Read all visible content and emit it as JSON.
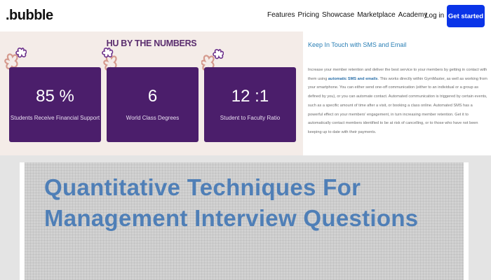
{
  "nav": {
    "logo": ".bubble",
    "links": [
      "Features",
      "Pricing",
      "Showcase",
      "Marketplace",
      "Academy"
    ],
    "login": "Log in",
    "cta": "Get started"
  },
  "stats": {
    "title": "HU BY THE NUMBERS",
    "cards": [
      {
        "value": "85 %",
        "label": "Students Receive Financial Support"
      },
      {
        "value": "6",
        "label": "World Class Degrees"
      },
      {
        "value": "12 :1",
        "label": "Student to Faculty Ratio"
      }
    ]
  },
  "info": {
    "title": "Keep In Touch with SMS and Email",
    "intro": "Increase your member retention and deliver the best service to your members by getting in contact with them using ",
    "highlight": "automatic SMS and emails",
    "rest": ". This works directly within GymMaster, as well as working from your smartphone. You can either send one-off communication (either to an individual or a group as defined by you), or you can automate contact. Automated communication is triggered by certain events, such as a specific amount of time after a visit, or booking a class online. Automated SMS has a powerful effect on your members' engagement, in turn increasing member retention. Get it to automatically contact members identified to be at risk of cancelling, or to those who have not been keeping up to date with their payments."
  },
  "banner": {
    "title": "Quantitative Techniques For Management Interview Questions"
  },
  "colors": {
    "brand_blue": "#0a34e8",
    "card_purple": "#4b1e6b",
    "stats_bg": "#f4ece8",
    "info_title": "#2a7fb5",
    "banner_text": "#4f7fb7"
  }
}
